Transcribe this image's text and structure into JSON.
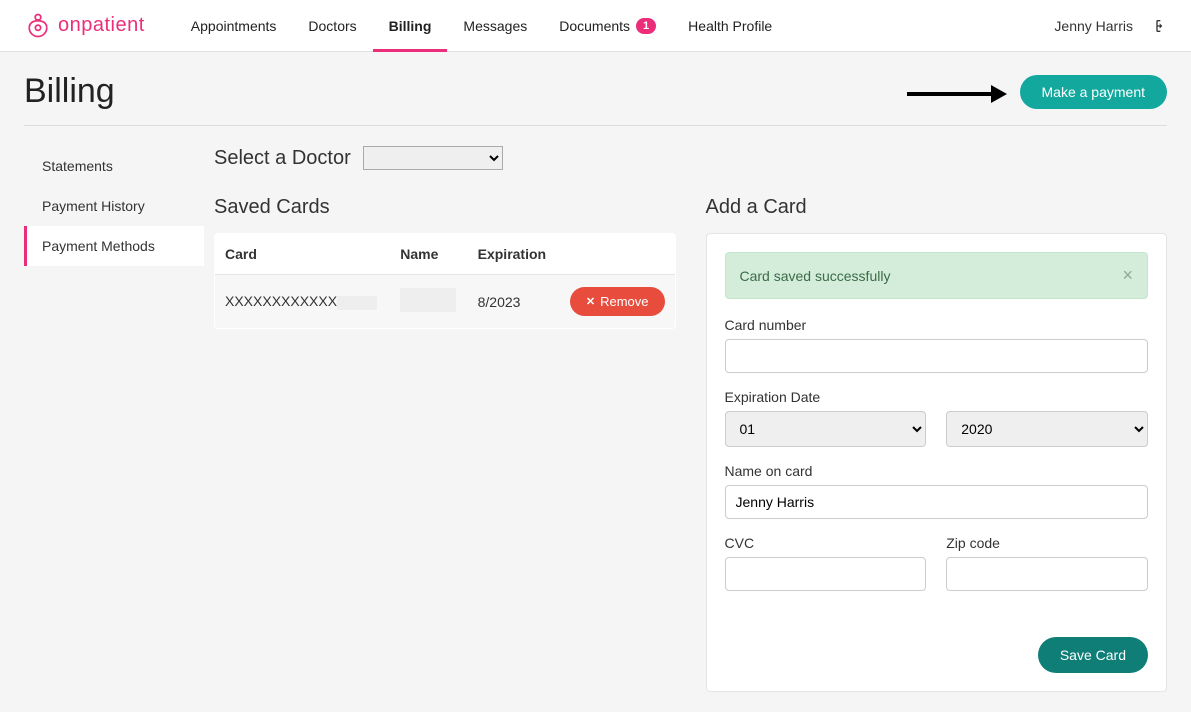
{
  "brand": {
    "name": "onpatient"
  },
  "nav": {
    "items": [
      {
        "label": "Appointments",
        "active": false,
        "badge": null
      },
      {
        "label": "Doctors",
        "active": false,
        "badge": null
      },
      {
        "label": "Billing",
        "active": true,
        "badge": null
      },
      {
        "label": "Messages",
        "active": false,
        "badge": null
      },
      {
        "label": "Documents",
        "active": false,
        "badge": "1"
      },
      {
        "label": "Health Profile",
        "active": false,
        "badge": null
      }
    ]
  },
  "user": {
    "name": "Jenny Harris"
  },
  "page": {
    "title": "Billing",
    "cta": "Make a payment"
  },
  "sidebar": {
    "items": [
      {
        "label": "Statements",
        "active": false
      },
      {
        "label": "Payment History",
        "active": false
      },
      {
        "label": "Payment Methods",
        "active": true
      }
    ]
  },
  "doctor": {
    "label": "Select a Doctor",
    "value": ""
  },
  "savedCards": {
    "title": "Saved Cards",
    "columns": {
      "card": "Card",
      "name": "Name",
      "expiration": "Expiration"
    },
    "rows": [
      {
        "card_masked": "XXXXXXXXXXXX",
        "expiration": "8/2023",
        "remove": "Remove"
      }
    ]
  },
  "addCard": {
    "title": "Add a Card",
    "alert": {
      "text": "Card saved successfully"
    },
    "fields": {
      "cardNumberLabel": "Card number",
      "cardNumberValue": "",
      "expirationLabel": "Expiration Date",
      "expMonth": "01",
      "expYear": "2020",
      "nameLabel": "Name on card",
      "nameValue": "Jenny Harris",
      "cvcLabel": "CVC",
      "cvcValue": "",
      "zipLabel": "Zip code",
      "zipValue": ""
    },
    "submit": "Save Card"
  }
}
